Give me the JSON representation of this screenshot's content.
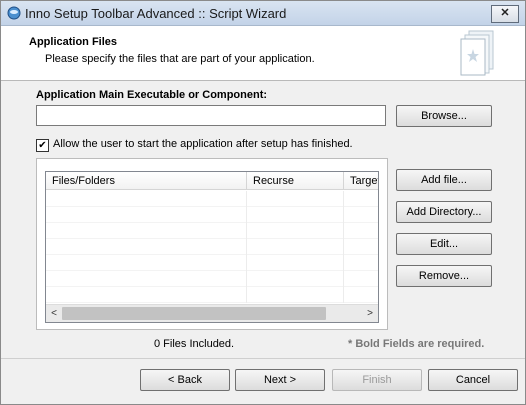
{
  "window": {
    "title": "Inno Setup Toolbar Advanced :: Script Wizard",
    "close_glyph": "✕"
  },
  "header": {
    "title": "Application Files",
    "subtitle": "Please specify the files that are part of your application."
  },
  "main_exe": {
    "label": "Application Main Executable or Component:",
    "value": "",
    "browse_label": "Browse..."
  },
  "allow_start": {
    "checked": true,
    "check_glyph": "✔",
    "label": "Allow the user to start the application after setup has finished."
  },
  "files_list": {
    "columns": [
      "Files/Folders",
      "Recurse",
      "Target F"
    ],
    "rows": []
  },
  "side_buttons": {
    "add_file": "Add file...",
    "add_directory": "Add Directory...",
    "edit": "Edit...",
    "remove": "Remove..."
  },
  "scroll": {
    "left_glyph": "<",
    "right_glyph": ">"
  },
  "status": {
    "count": "0 Files Included.",
    "required_note": "* Bold Fields are required."
  },
  "nav": {
    "back": "< Back",
    "next": "Next >",
    "finish": "Finish",
    "cancel": "Cancel"
  },
  "icons": {
    "app": "inno-setup-icon",
    "header": "document-star-icon"
  }
}
